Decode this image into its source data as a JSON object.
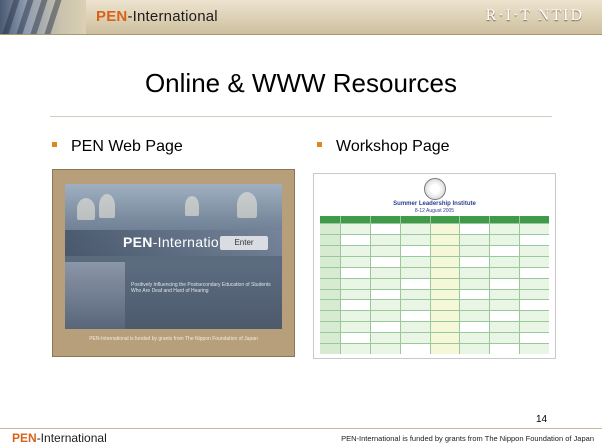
{
  "header": {
    "brand_pen": "PEN",
    "brand_rest": "-International",
    "rit_ntid": "R·I·T  NTID"
  },
  "slide": {
    "title": "Online & WWW Resources",
    "bullets": [
      {
        "label": "PEN Web Page"
      },
      {
        "label": "Workshop Page"
      }
    ],
    "page_number": "14"
  },
  "pen_web_thumb": {
    "logo_pen": "PEN",
    "logo_rest": "-International",
    "enter_label": "Enter",
    "blurb": "Positively Influencing the Postsecondary Education of Students Who Are Deaf and Hard of Hearing",
    "footer": "PEN-International is funded by grants from The Nippon Foundation of Japan"
  },
  "workshop_thumb": {
    "title": "Summer Leadership Institute",
    "date": "8-12 August 2005"
  },
  "footer": {
    "brand_pen": "PEN",
    "brand_rest": "-International",
    "funding": "PEN-International is funded by grants from The Nippon Foundation of Japan"
  },
  "colors": {
    "accent": "#d8621a",
    "bullet": "#e0861e",
    "header_band": "#dcd0b4",
    "workshop_green": "#3f9a49"
  }
}
